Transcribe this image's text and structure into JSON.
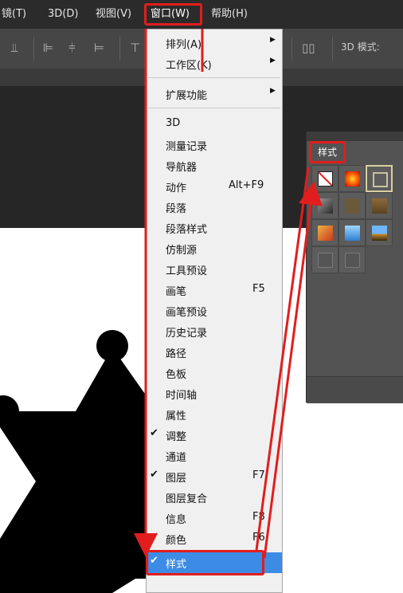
{
  "menubar": {
    "items": [
      {
        "label": "镜(T)"
      },
      {
        "label": "3D(D)"
      },
      {
        "label": "视图(V)"
      },
      {
        "label": "窗口(W)"
      },
      {
        "label": "帮助(H)"
      }
    ]
  },
  "toolbar": {
    "mode_label": "3D 模式:"
  },
  "menu": {
    "items": [
      {
        "label": "排列(A)",
        "submenu": true
      },
      {
        "label": "工作区(K)",
        "submenu": true
      },
      {
        "label": "扩展功能",
        "submenu": true
      },
      {
        "label": "3D"
      },
      {
        "label": "测量记录"
      },
      {
        "label": "导航器"
      },
      {
        "label": "动作",
        "shortcut": "Alt+F9"
      },
      {
        "label": "段落"
      },
      {
        "label": "段落样式"
      },
      {
        "label": "仿制源"
      },
      {
        "label": "工具预设"
      },
      {
        "label": "画笔",
        "shortcut": "F5"
      },
      {
        "label": "画笔预设"
      },
      {
        "label": "历史记录"
      },
      {
        "label": "路径"
      },
      {
        "label": "色板"
      },
      {
        "label": "时间轴"
      },
      {
        "label": "属性"
      },
      {
        "label": "调整",
        "checked": true
      },
      {
        "label": "通道"
      },
      {
        "label": "图层",
        "checked": true,
        "shortcut": "F7"
      },
      {
        "label": "图层复合"
      },
      {
        "label": "信息",
        "shortcut": "F8"
      },
      {
        "label": "颜色",
        "checked": true,
        "shortcut": "F6"
      },
      {
        "label": "样式",
        "checked": true,
        "selected": true
      }
    ]
  },
  "style_panel": {
    "tab_label": "样式"
  },
  "colors": {
    "annotation": "#e21d1d",
    "highlight": "#3c8ce6"
  }
}
